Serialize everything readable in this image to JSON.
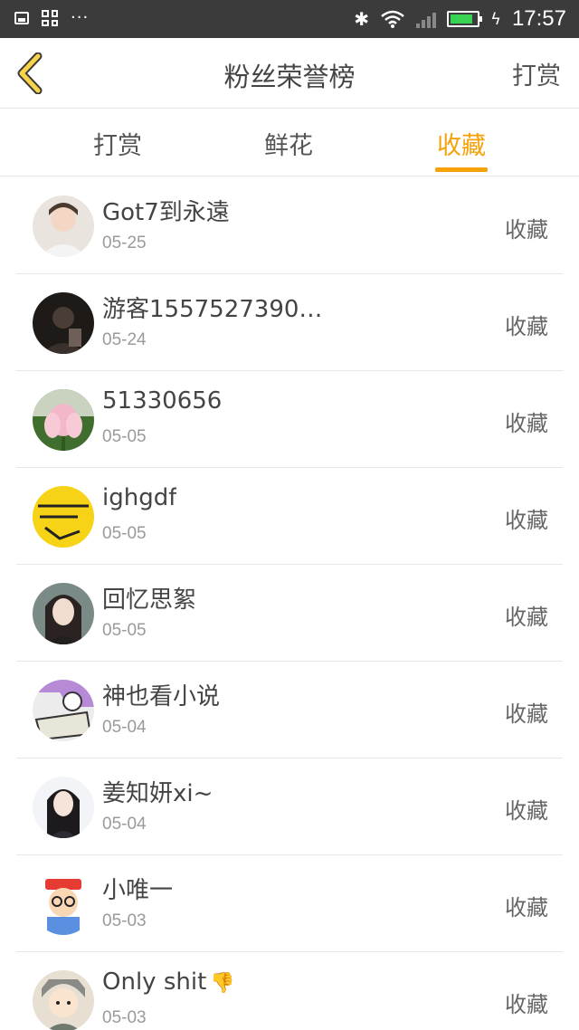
{
  "status_bar": {
    "time": "17:57",
    "icons": [
      "gallery-icon",
      "grid-icon",
      "more-dots-icon",
      "bluetooth-icon",
      "wifi-icon",
      "signal-icon",
      "battery-icon",
      "charging-icon"
    ]
  },
  "nav": {
    "back_icon": "chevron-left-icon",
    "title": "粉丝荣誉榜",
    "action": "打赏",
    "accent_color": "#f5a20a"
  },
  "tabs": [
    {
      "label": "打赏",
      "active": false
    },
    {
      "label": "鲜花",
      "active": false
    },
    {
      "label": "收藏",
      "active": true
    }
  ],
  "list": [
    {
      "name": "Got7到永遠",
      "date": "05-25",
      "action": "收藏",
      "avatar": "portrait-boy"
    },
    {
      "name": "游客1557527390…",
      "date": "05-24",
      "action": "收藏",
      "avatar": "dark-portrait"
    },
    {
      "name": "51330656",
      "date": "05-05",
      "action": "收藏",
      "avatar": "lotus-flower"
    },
    {
      "name": "ighgdf",
      "date": "05-05",
      "action": "收藏",
      "avatar": "yellow-text"
    },
    {
      "name": "回忆思絮",
      "date": "05-05",
      "action": "收藏",
      "avatar": "portrait-girl"
    },
    {
      "name": "神也看小说",
      "date": "05-04",
      "action": "收藏",
      "avatar": "comic-drawing"
    },
    {
      "name": "姜知妍xi~",
      "date": "05-04",
      "action": "收藏",
      "avatar": "portrait-girl-2"
    },
    {
      "name": "小唯一",
      "date": "05-03",
      "action": "收藏",
      "avatar": "arale-cartoon"
    },
    {
      "name": "Only  shit",
      "date": "05-03",
      "action": "收藏",
      "avatar": "cartoon-kid",
      "name_emoji": "👎"
    }
  ]
}
